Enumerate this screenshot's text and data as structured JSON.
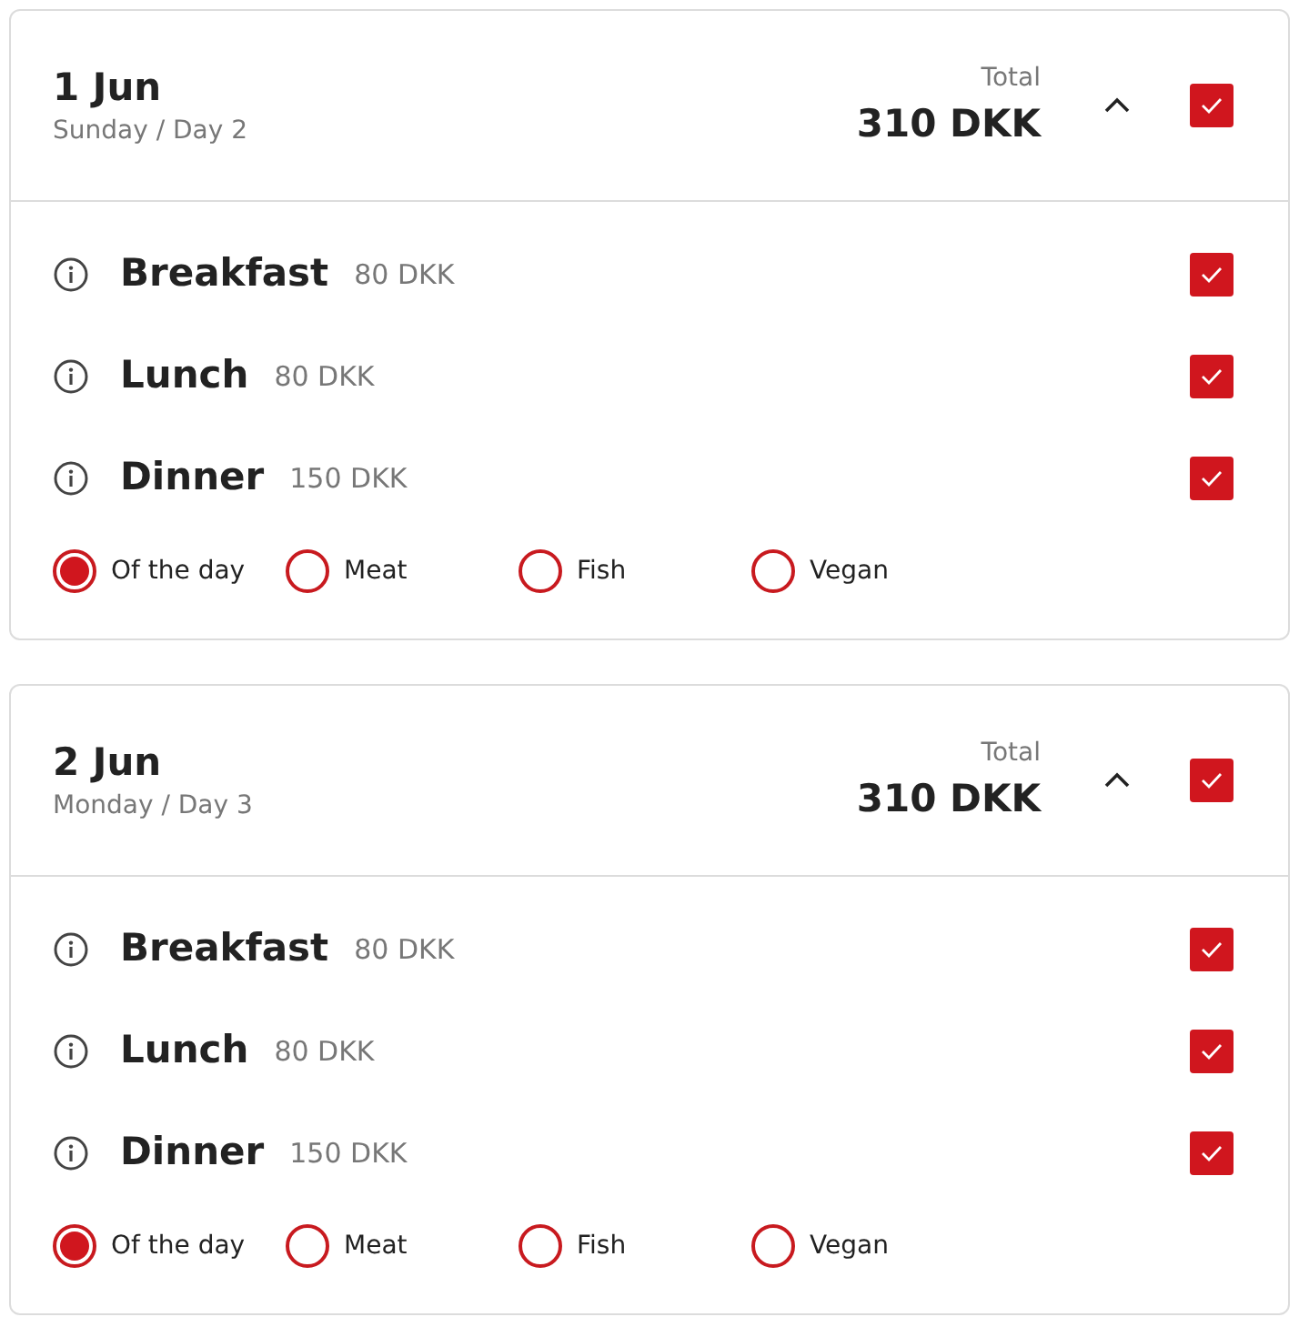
{
  "days": [
    {
      "date": "1 Jun",
      "subtitle": "Sunday / Day 2",
      "total_label": "Total",
      "total": "310 DKK",
      "expanded": true,
      "checked": true,
      "meals": [
        {
          "name": "Breakfast",
          "price": "80 DKK",
          "checked": true
        },
        {
          "name": "Lunch",
          "price": "80 DKK",
          "checked": true
        },
        {
          "name": "Dinner",
          "price": "150 DKK",
          "checked": true
        }
      ],
      "options": [
        {
          "label": "Of the day",
          "selected": true
        },
        {
          "label": "Meat",
          "selected": false
        },
        {
          "label": "Fish",
          "selected": false
        },
        {
          "label": "Vegan",
          "selected": false
        }
      ]
    },
    {
      "date": "2 Jun",
      "subtitle": "Monday / Day 3",
      "total_label": "Total",
      "total": "310 DKK",
      "expanded": true,
      "checked": true,
      "meals": [
        {
          "name": "Breakfast",
          "price": "80 DKK",
          "checked": true
        },
        {
          "name": "Lunch",
          "price": "80 DKK",
          "checked": true
        },
        {
          "name": "Dinner",
          "price": "150 DKK",
          "checked": true
        }
      ],
      "options": [
        {
          "label": "Of the day",
          "selected": true
        },
        {
          "label": "Meat",
          "selected": false
        },
        {
          "label": "Fish",
          "selected": false
        },
        {
          "label": "Vegan",
          "selected": false
        }
      ]
    }
  ]
}
